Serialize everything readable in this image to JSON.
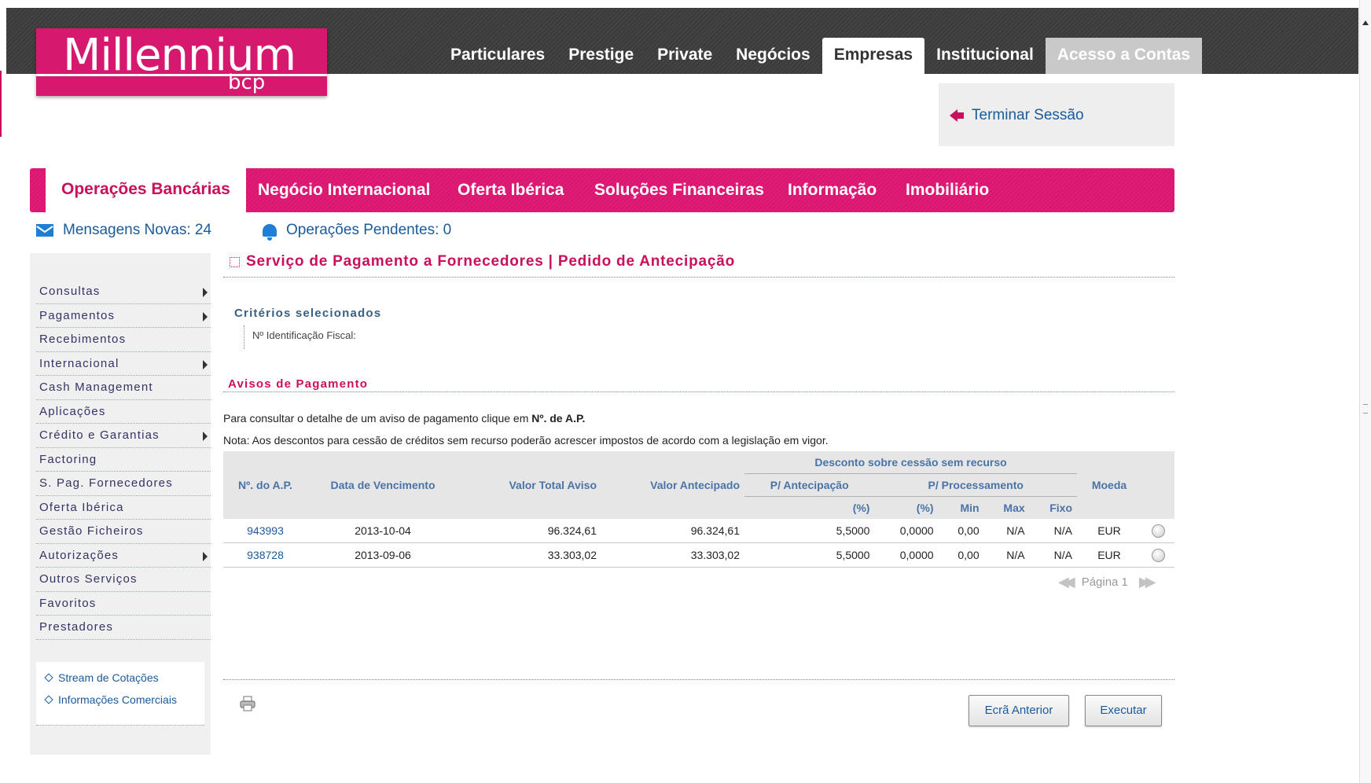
{
  "brand": {
    "name": "Millennium",
    "sub": "bcp"
  },
  "topnav": [
    {
      "label": "Particulares"
    },
    {
      "label": "Prestige"
    },
    {
      "label": "Private"
    },
    {
      "label": "Negócios"
    },
    {
      "label": "Empresas",
      "active": true
    },
    {
      "label": "Institucional"
    },
    {
      "label": "Acesso a Contas",
      "access": true
    }
  ],
  "session": {
    "logout_label": "Terminar Sessão"
  },
  "pinknav": {
    "tabs": [
      {
        "label": "Operações Bancárias",
        "active": true
      },
      {
        "label": "Negócio Internacional"
      },
      {
        "label": "Oferta Ibérica"
      },
      {
        "label": "Soluções Financeiras"
      },
      {
        "label": "Informação"
      },
      {
        "label": "Imobiliário"
      }
    ]
  },
  "status": {
    "messages": "Mensagens Novas: 24",
    "pending": "Operações Pendentes: 0"
  },
  "sidebar": {
    "items": [
      {
        "label": "Consultas",
        "submenu": true
      },
      {
        "label": "Pagamentos",
        "submenu": true
      },
      {
        "label": "Recebimentos"
      },
      {
        "label": "Internacional",
        "submenu": true
      },
      {
        "label": "Cash Management"
      },
      {
        "label": "Aplicações"
      },
      {
        "label": "Crédito e Garantias",
        "submenu": true
      },
      {
        "label": "Factoring"
      },
      {
        "label": "S. Pag. Fornecedores"
      },
      {
        "label": "Oferta Ibérica"
      },
      {
        "label": "Gestão Ficheiros"
      },
      {
        "label": "Autorizações",
        "submenu": true
      },
      {
        "label": "Outros Serviços"
      },
      {
        "label": "Favoritos"
      },
      {
        "label": "Prestadores"
      }
    ],
    "links": [
      {
        "label": "Stream de Cotações"
      },
      {
        "label": "Informações Comerciais"
      }
    ]
  },
  "main": {
    "title": "Serviço de Pagamento a Fornecedores | Pedido de Antecipação",
    "criteria_title": "Critérios selecionados",
    "criteria_field": "Nº Identificação Fiscal:",
    "section_title": "Avisos de Pagamento",
    "info1_prefix": "Para consultar o detalhe de um aviso de pagamento clique em ",
    "info1_bold": "Nº. de A.P.",
    "info2": "Nota: Aos descontos para cessão de créditos sem recurso poderão acrescer impostos de acordo com a legislação em vigor.",
    "table": {
      "group_header": "Desconto sobre cessão sem recurso",
      "headers": {
        "num": "Nº. do A.P.",
        "date": "Data de Vencimento",
        "total": "Valor Total Aviso",
        "advanced": "Valor Antecipado",
        "p_ant": "P/ Antecipação",
        "p_proc": "P/ Processamento",
        "currency": "Moeda",
        "pct1": "(%)",
        "pct2": "(%)",
        "min": "Min",
        "max": "Max",
        "fixo": "Fixo"
      },
      "rows": [
        {
          "num": "943993",
          "date": "2013-10-04",
          "total": "96.324,61",
          "advanced": "96.324,61",
          "p_ant": "5,5000",
          "p_proc": "0,0000",
          "min": "0,00",
          "max": "N/A",
          "fixo": "N/A",
          "currency": "EUR"
        },
        {
          "num": "938728",
          "date": "2013-09-06",
          "total": "33.303,02",
          "advanced": "33.303,02",
          "p_ant": "5,5000",
          "p_proc": "0,0000",
          "min": "0,00",
          "max": "N/A",
          "fixo": "N/A",
          "currency": "EUR"
        }
      ]
    },
    "pager": {
      "label": "Página 1"
    },
    "buttons": {
      "back": "Ecrã Anterior",
      "execute": "Executar"
    }
  },
  "colors": {
    "brand": "#d6186e",
    "link": "#1b5a9a",
    "topbar": "#3f3f3f"
  }
}
